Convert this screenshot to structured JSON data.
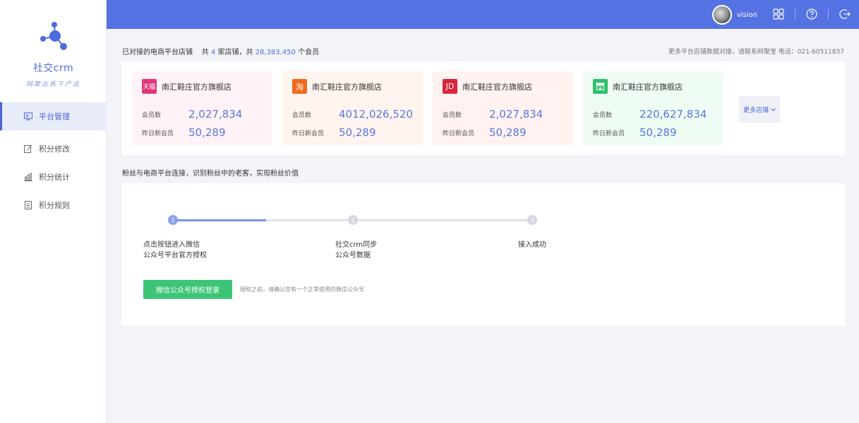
{
  "brand": {
    "name": "社交crm",
    "slogan": "网聚出拣下产品",
    "accent": "#5472e2"
  },
  "sidebar": {
    "items": [
      {
        "label": "平台管理",
        "icon": "monitor-icon",
        "active": true
      },
      {
        "label": "积分修改",
        "icon": "edit-icon",
        "active": false
      },
      {
        "label": "积分统计",
        "icon": "bar-chart-icon",
        "active": false
      },
      {
        "label": "积分规则",
        "icon": "document-icon",
        "active": false
      }
    ]
  },
  "topbar": {
    "username": "vision",
    "icons": [
      "apps-icon",
      "help-icon",
      "logout-icon"
    ]
  },
  "summary": {
    "title": "已对接的电商平台店铺",
    "prefix": "共",
    "shop_count": "4",
    "middle": "家店铺，共",
    "member_count": "28,383,450",
    "suffix": "个会员",
    "contact": "更多平台店铺数据对接，请联系网聚宝  电话：021-60511837"
  },
  "shops": [
    {
      "platform": "天猫",
      "name": "南汇鞋庄官方旗舰店",
      "members_label": "会员数",
      "members": "2,027,834",
      "new_label": "昨日新会员",
      "new_members": "50,289",
      "color": "#e0367a",
      "bg": "#fff3f8"
    },
    {
      "platform": "淘",
      "name": "南汇鞋庄官方旗舰店",
      "members_label": "会员数",
      "members": "4012,026,520",
      "new_label": "昨日新会员",
      "new_members": "50,289",
      "color": "#f06a1d",
      "bg": "#fff4ef"
    },
    {
      "platform": "JD",
      "name": "南汇鞋庄官方旗舰店",
      "members_label": "会员数",
      "members": "2,027,834",
      "new_label": "昨日新会员",
      "new_members": "50,289",
      "color": "#d7263a",
      "bg": "#fff2f1"
    },
    {
      "platform": "",
      "name": "南汇鞋庄官方旗舰店",
      "members_label": "会员数",
      "members": "220,627,834",
      "new_label": "昨日新会员",
      "new_members": "50,289",
      "color": "#2fbf6c",
      "bg": "#eefcf4"
    }
  ],
  "more_shops": "更多店铺",
  "fans": {
    "title": "粉丝与电商平台连接，识别粉丝中的老客，实现粉丝价值",
    "steps": [
      {
        "num": "1",
        "line1": "点击按钮进入微信",
        "line2": "公众号平台官方授权"
      },
      {
        "num": "2",
        "line1": "社交crm同步",
        "line2": "公众号数据"
      },
      {
        "num": "3",
        "line1": "接入成功",
        "line2": ""
      }
    ],
    "progress_fraction": 0.26,
    "button": "微信公众号授权登录",
    "note": "授权之前，请确认您有一个正常使用的微信公众号"
  }
}
